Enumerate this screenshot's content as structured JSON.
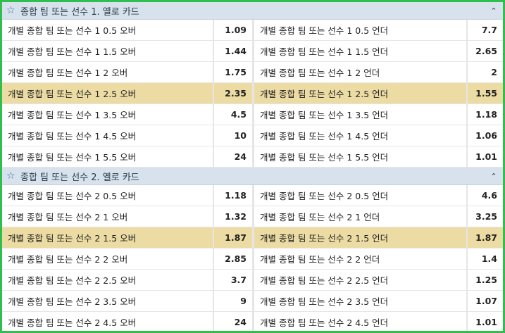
{
  "sections": [
    {
      "title": "종합 팀 또는 선수 1. 옐로 카드",
      "rows": [
        {
          "over_label": "개별 종합 팀 또는 선수 1 0.5 오버",
          "over_odds": "1.09",
          "under_label": "개별 종합 팀 또는 선수 1 0.5 언더",
          "under_odds": "7.7",
          "highlight": false
        },
        {
          "over_label": "개별 종합 팀 또는 선수 1 1.5 오버",
          "over_odds": "1.44",
          "under_label": "개별 종합 팀 또는 선수 1 1.5 언더",
          "under_odds": "2.65",
          "highlight": false
        },
        {
          "over_label": "개별 종합 팀 또는 선수 1 2 오버",
          "over_odds": "1.75",
          "under_label": "개별 종합 팀 또는 선수 1 2 언더",
          "under_odds": "2",
          "highlight": false
        },
        {
          "over_label": "개별 종합 팀 또는 선수 1 2.5 오버",
          "over_odds": "2.35",
          "under_label": "개별 종합 팀 또는 선수 1 2.5 언더",
          "under_odds": "1.55",
          "highlight": true
        },
        {
          "over_label": "개별 종합 팀 또는 선수 1 3.5 오버",
          "over_odds": "4.5",
          "under_label": "개별 종합 팀 또는 선수 1 3.5 언더",
          "under_odds": "1.18",
          "highlight": false
        },
        {
          "over_label": "개별 종합 팀 또는 선수 1 4.5 오버",
          "over_odds": "10",
          "under_label": "개별 종합 팀 또는 선수 1 4.5 언더",
          "under_odds": "1.06",
          "highlight": false
        },
        {
          "over_label": "개별 종합 팀 또는 선수 1 5.5 오버",
          "over_odds": "24",
          "under_label": "개별 종합 팀 또는 선수 1 5.5 언더",
          "under_odds": "1.01",
          "highlight": false
        }
      ]
    },
    {
      "title": "종합 팀 또는 선수 2. 옐로 카드",
      "rows": [
        {
          "over_label": "개별 종합 팀 또는 선수 2 0.5 오버",
          "over_odds": "1.18",
          "under_label": "개별 종합 팀 또는 선수 2 0.5 언더",
          "under_odds": "4.6",
          "highlight": false
        },
        {
          "over_label": "개별 종합 팀 또는 선수 2 1 오버",
          "over_odds": "1.32",
          "under_label": "개별 종합 팀 또는 선수 2 1 언더",
          "under_odds": "3.25",
          "highlight": false
        },
        {
          "over_label": "개별 종합 팀 또는 선수 2 1.5 오버",
          "over_odds": "1.87",
          "under_label": "개별 종합 팀 또는 선수 2 1.5 언더",
          "under_odds": "1.87",
          "highlight": true
        },
        {
          "over_label": "개별 종합 팀 또는 선수 2 2 오버",
          "over_odds": "2.85",
          "under_label": "개별 종합 팀 또는 선수 2 2 언더",
          "under_odds": "1.4",
          "highlight": false
        },
        {
          "over_label": "개별 종합 팀 또는 선수 2 2.5 오버",
          "over_odds": "3.7",
          "under_label": "개별 종합 팀 또는 선수 2 2.5 언더",
          "under_odds": "1.25",
          "highlight": false
        },
        {
          "over_label": "개별 종합 팀 또는 선수 2 3.5 오버",
          "over_odds": "9",
          "under_label": "개별 종합 팀 또는 선수 2 3.5 언더",
          "under_odds": "1.07",
          "highlight": false
        },
        {
          "over_label": "개별 종합 팀 또는 선수 2 4.5 오버",
          "over_odds": "24",
          "under_label": "개별 종합 팀 또는 선수 2 4.5 언더",
          "under_odds": "1.01",
          "highlight": false
        }
      ]
    }
  ],
  "icons": {
    "favorite": "☆",
    "collapse": "⌃"
  },
  "colors": {
    "border": "#2fbf4f",
    "header_bg": "#d7e2ec",
    "highlight": "#ecdca4",
    "star": "#3d6fb0"
  }
}
